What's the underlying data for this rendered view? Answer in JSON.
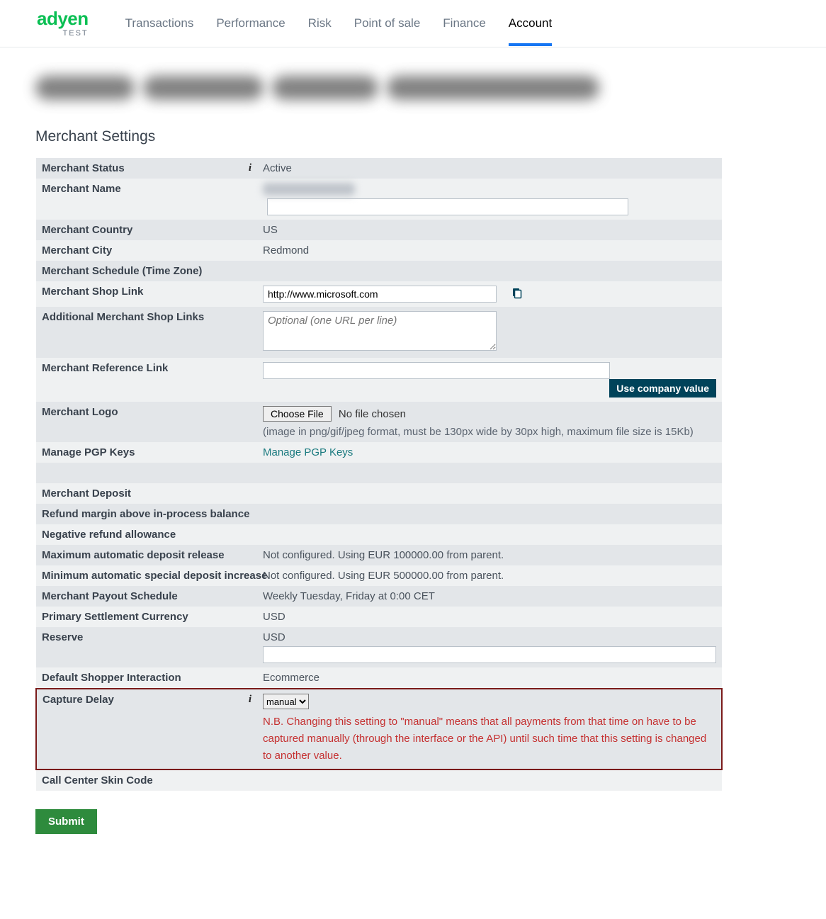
{
  "brand": {
    "name": "adyen",
    "env": "TEST"
  },
  "nav": {
    "items": [
      {
        "label": "Transactions",
        "active": false
      },
      {
        "label": "Performance",
        "active": false
      },
      {
        "label": "Risk",
        "active": false
      },
      {
        "label": "Point of sale",
        "active": false
      },
      {
        "label": "Finance",
        "active": false
      },
      {
        "label": "Account",
        "active": true
      }
    ]
  },
  "section_title": "Merchant Settings",
  "labels": {
    "merchant_status": "Merchant Status",
    "merchant_name": "Merchant Name",
    "merchant_country": "Merchant Country",
    "merchant_city": "Merchant City",
    "merchant_schedule": "Merchant Schedule (Time Zone)",
    "merchant_shop_link": "Merchant Shop Link",
    "additional_links": "Additional Merchant Shop Links",
    "merchant_reference_link": "Merchant Reference Link",
    "merchant_logo": "Merchant Logo",
    "manage_pgp": "Manage PGP Keys",
    "merchant_deposit": "Merchant Deposit",
    "refund_margin": "Refund margin above in-process balance",
    "negative_refund": "Negative refund allowance",
    "max_auto_deposit": "Maximum automatic deposit release",
    "min_auto_special": "Minimum automatic special deposit increase",
    "payout_schedule": "Merchant Payout Schedule",
    "primary_settlement": "Primary Settlement Currency",
    "reserve": "Reserve",
    "default_shopper": "Default Shopper Interaction",
    "capture_delay": "Capture Delay",
    "call_center_skin": "Call Center Skin Code"
  },
  "values": {
    "merchant_status": "Active",
    "merchant_country": "US",
    "merchant_city": "Redmond",
    "merchant_shop_link": "http://www.microsoft.com",
    "additional_links_placeholder": "Optional (one URL per line)",
    "use_company_value": "Use company value",
    "choose_file": "Choose File",
    "no_file_chosen": "No file chosen",
    "logo_hint": "(image in png/gif/jpeg format, must be 130px wide by 30px high, maximum file size is 15Kb)",
    "manage_pgp_link": "Manage PGP Keys",
    "max_auto_deposit": "Not configured. Using EUR 100000.00 from parent.",
    "min_auto_special": "Not configured. Using EUR 500000.00 from parent.",
    "payout_schedule": "Weekly Tuesday, Friday at 0:00 CET",
    "primary_settlement": "USD",
    "reserve": "USD",
    "default_shopper": "Ecommerce",
    "capture_delay_selected": "manual",
    "capture_delay_warning": "N.B. Changing this setting to \"manual\" means that all payments from that time on have to be captured manually (through the interface or the API) until such time that this setting is changed to another value."
  },
  "submit_label": "Submit",
  "colors": {
    "brand_green": "#0abf53",
    "accent_blue": "#1676f3",
    "warn_red": "#c53030",
    "dark_teal": "#00435a"
  }
}
